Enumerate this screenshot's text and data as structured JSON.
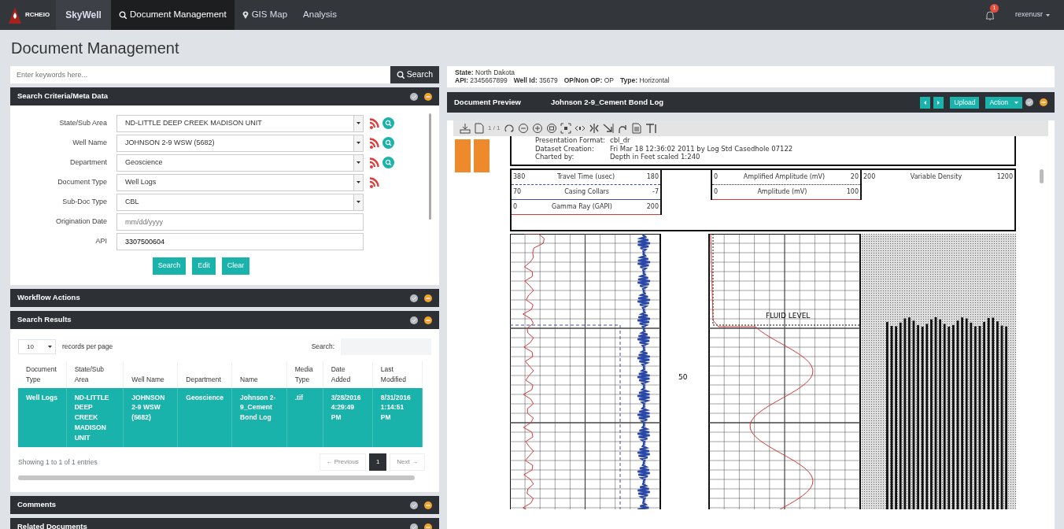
{
  "nav": {
    "logo_text": "RCHEIO",
    "brand": "SkyWell",
    "items": [
      {
        "label": "Document Management",
        "kind": "search",
        "selected": true
      },
      {
        "label": "GIS Map",
        "kind": "pin",
        "selected": false
      },
      {
        "label": "Analysis",
        "kind": "plain",
        "selected": false
      }
    ],
    "notification_count": "1",
    "user": "rexenusr"
  },
  "page_title": "Document Management",
  "keyword_search": {
    "placeholder": "Enter keywords here...",
    "button": "Search"
  },
  "left_panels": [
    {
      "title": "Search Criteria/Meta Data",
      "kind": "criteria",
      "fields": [
        {
          "label": "State/Sub Area",
          "kind": "select",
          "value": "ND-LITTLE DEEP CREEK MADISON UNIT",
          "rss": true,
          "lookup": true
        },
        {
          "label": "Well Name",
          "kind": "select",
          "value": "JOHNSON 2-9 WSW (5682)",
          "rss": true,
          "lookup": true
        },
        {
          "label": "Department",
          "kind": "select",
          "value": "Geoscience",
          "rss": true,
          "lookup": true
        },
        {
          "label": "Document Type",
          "kind": "select",
          "value": "Well Logs",
          "rss": true,
          "lookup": false
        },
        {
          "label": "Sub-Doc Type",
          "kind": "select",
          "value": "CBL",
          "rss": false,
          "lookup": false
        },
        {
          "label": "Origination Date",
          "kind": "input",
          "placeholder": "mm/dd/yyyy",
          "rss": false,
          "lookup": false
        },
        {
          "label": "API",
          "kind": "input",
          "value": "3307500604",
          "rss": false,
          "lookup": false
        }
      ],
      "buttons": [
        "Search",
        "Edit",
        "Clear"
      ]
    },
    {
      "title": "Workflow Actions",
      "kind": "empty"
    },
    {
      "title": "Search Results",
      "kind": "results",
      "page_size": "10",
      "page_size_label": "records per page",
      "search_label": "Search:",
      "columns": [
        "Document Type",
        "State/Sub Area",
        "Well Name",
        "Department",
        "Name",
        "Media Type",
        "Date Added",
        "Last Modified"
      ],
      "rows": [
        {
          "selected": true,
          "cells": [
            "Well Logs",
            "ND-LITTLE DEEP CREEK MADISON UNIT",
            "JOHNSON 2-9 WSW (5682)",
            "Geoscience",
            "Johnson 2-9_Cement Bond Log",
            ".tif",
            "3/28/2016 4:29:49 PM",
            "8/31/2016 1:14:51 PM"
          ]
        }
      ],
      "info": "Showing 1 to 1 of 1 entries",
      "pages": [
        {
          "label": "← Previous",
          "selected": false,
          "disabled": true
        },
        {
          "label": "1",
          "selected": true,
          "disabled": false
        },
        {
          "label": "Next →",
          "selected": false,
          "disabled": true
        }
      ]
    },
    {
      "title": "Comments",
      "kind": "empty"
    },
    {
      "title": "Related Documents",
      "kind": "empty"
    }
  ],
  "well_info": [
    [
      {
        "key": "State:",
        "value": "North Dakota"
      }
    ],
    [
      {
        "key": "API:",
        "value": "2345667899"
      },
      {
        "key": "Well Id:",
        "value": "35679"
      },
      {
        "key": "OP/Non OP:",
        "value": "OP"
      },
      {
        "key": "Type:",
        "value": "Horizontal"
      }
    ]
  ],
  "preview": {
    "title": "Document Preview",
    "document": "Johnson 2-9_Cement Bond Log",
    "upload": "Upload",
    "action": "Action",
    "page": "1 / 1",
    "log": {
      "header_lines": [
        {
          "label": "Presentation Format:",
          "value": "cbl_dr"
        },
        {
          "label": "Dataset Creation:",
          "value": "Fri Mar 18 12:36:02 2011 by Log Std Casedhole 07122"
        },
        {
          "label": "Charted by:",
          "value": "Depth in Feet scaled 1:240"
        }
      ],
      "scale_groups": [
        [
          {
            "min": "380",
            "name": "Travel Time (usec)",
            "max": "180",
            "kind": "dashed",
            "color": "#3a4fa8"
          },
          {
            "min": "70",
            "name": "Casing Collars",
            "max": "-7",
            "kind": "solid",
            "color": "#3a4fa8"
          },
          {
            "min": "0",
            "name": "Gamma Ray (GAPI)",
            "max": "200",
            "kind": "solid",
            "color": "#d43a3a"
          }
        ],
        [
          {
            "min": "0",
            "name": "Amplified Amplitude (mV)",
            "max": "20",
            "kind": "dotted",
            "color": "#222222"
          },
          {
            "min": "0",
            "name": "Amplitude (mV)",
            "max": "100",
            "kind": "solid",
            "color": "#d43a3a"
          }
        ],
        [
          {
            "min": "200",
            "name": "Variable Density",
            "max": "1200",
            "kind": "plain"
          }
        ]
      ],
      "depth_label": "50",
      "annotation": "FLUID LEVEL"
    }
  }
}
